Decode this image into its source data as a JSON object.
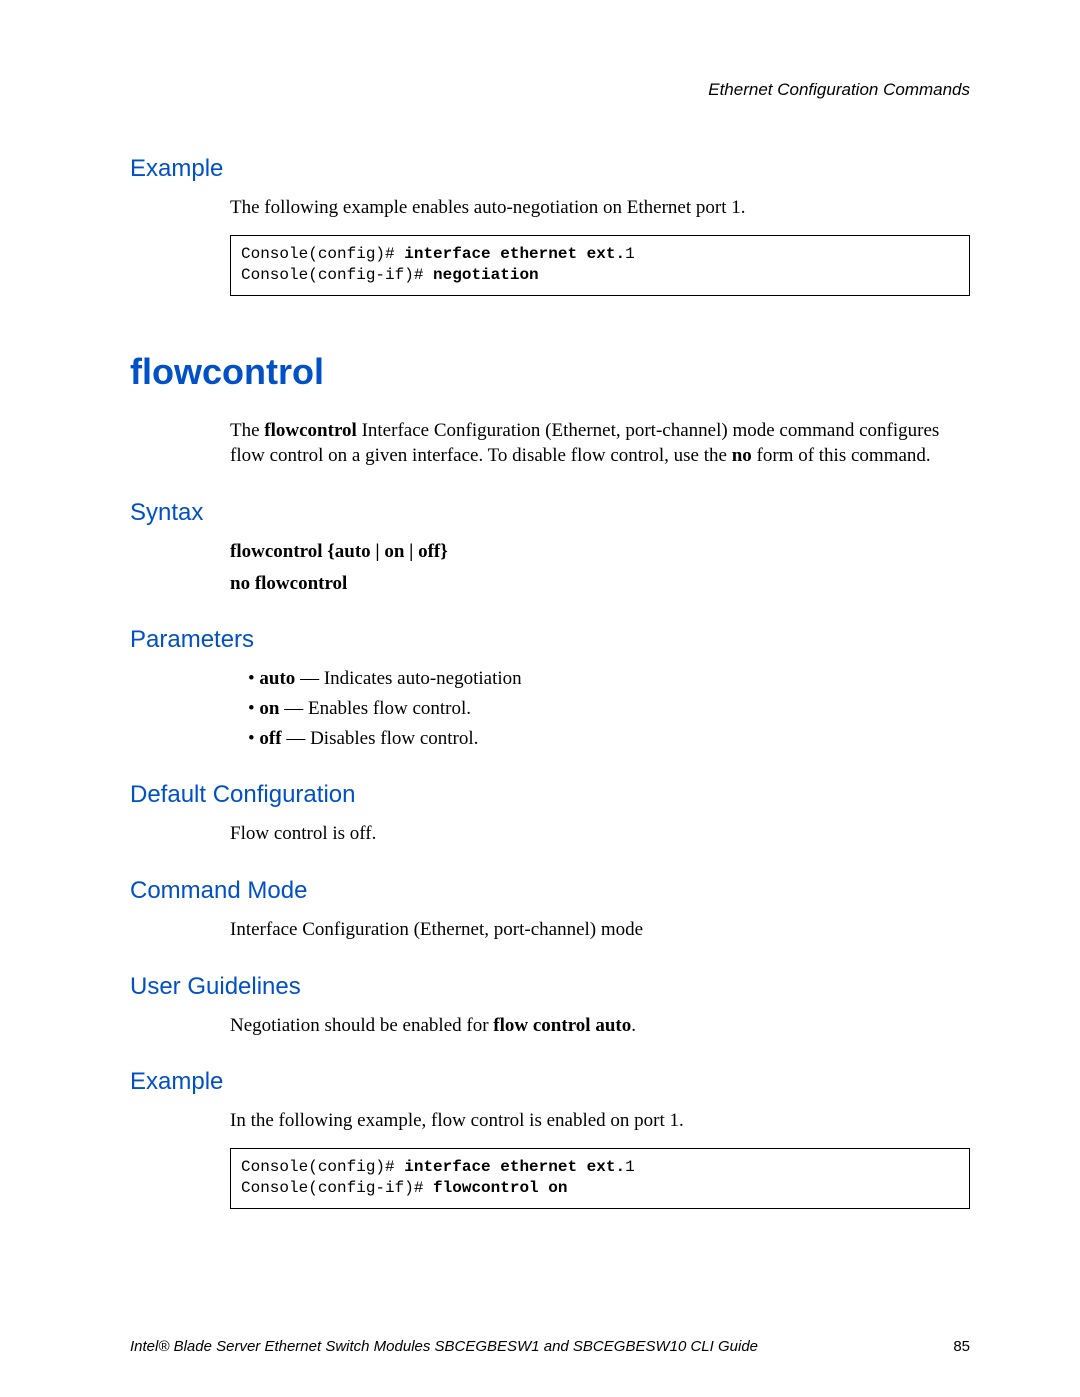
{
  "header": {
    "running": "Ethernet Configuration Commands"
  },
  "sec_example1": {
    "heading": "Example",
    "intro": "The following example enables auto-negotiation on Ethernet port 1.",
    "code_l1_prompt": "Console(config)# ",
    "code_l1_cmd": "interface ethernet ext.",
    "code_l1_arg": "1",
    "code_l2_prompt": "Console(config-if)# ",
    "code_l2_cmd": "negotiation"
  },
  "command": {
    "title": "flowcontrol",
    "desc_pre": "The ",
    "desc_bold": "flowcontrol",
    "desc_mid": " Interface Configuration (Ethernet, port-channel) mode command configures flow control on a given interface. To disable flow control, use the ",
    "desc_bold2": "no",
    "desc_post": " form of this command."
  },
  "syntax": {
    "heading": "Syntax",
    "line1": "flowcontrol {auto | on | off}",
    "line2": "no flowcontrol"
  },
  "params": {
    "heading": "Parameters",
    "p1_b": "auto",
    "p1_t": " — Indicates auto-negotiation",
    "p2_b": "on",
    "p2_t": " — Enables flow control.",
    "p3_b": "off",
    "p3_t": " — Disables flow control."
  },
  "defcfg": {
    "heading": "Default Configuration",
    "text": "Flow control is off."
  },
  "mode": {
    "heading": "Command Mode",
    "text": "Interface Configuration (Ethernet, port-channel) mode"
  },
  "guidelines": {
    "heading": "User Guidelines",
    "pre": "Negotiation should be enabled for ",
    "bold": "flow control auto",
    "post": "."
  },
  "sec_example2": {
    "heading": "Example",
    "intro": "In the following example, flow control is enabled on port 1.",
    "code_l1_prompt": "Console(config)# ",
    "code_l1_cmd": "interface ethernet ext.",
    "code_l1_arg": "1",
    "code_l2_prompt": "Console(config-if)# ",
    "code_l2_cmd": "flowcontrol on"
  },
  "footer": {
    "text": "Intel® Blade Server Ethernet Switch Modules SBCEGBESW1 and SBCEGBESW10 CLI Guide",
    "page": "85"
  }
}
